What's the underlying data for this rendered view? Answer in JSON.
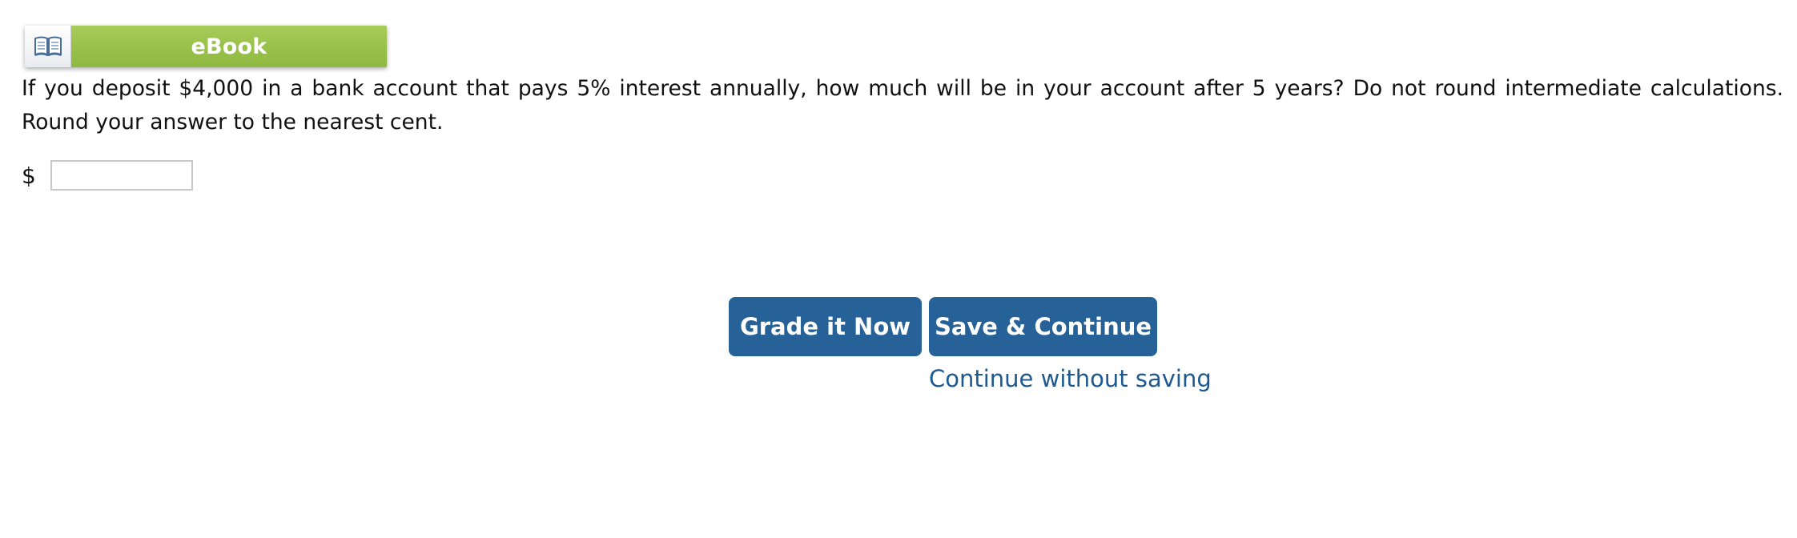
{
  "ebook": {
    "label": "eBook",
    "icon": "open-book-icon",
    "label_color": "#ffffff",
    "accent": "#99c24a"
  },
  "question": {
    "text": "If you deposit $4,000 in a bank account that pays 5% interest annually, how much will be in your account after 5 years? Do not round intermediate calculations. Round your answer to the nearest cent."
  },
  "answer": {
    "currency_symbol": "$",
    "value": "",
    "placeholder": ""
  },
  "actions": {
    "grade_label": "Grade it Now",
    "save_label": "Save & Continue",
    "continue_link": "Continue without saving",
    "button_color": "#266198",
    "link_color": "#1e5a91"
  }
}
